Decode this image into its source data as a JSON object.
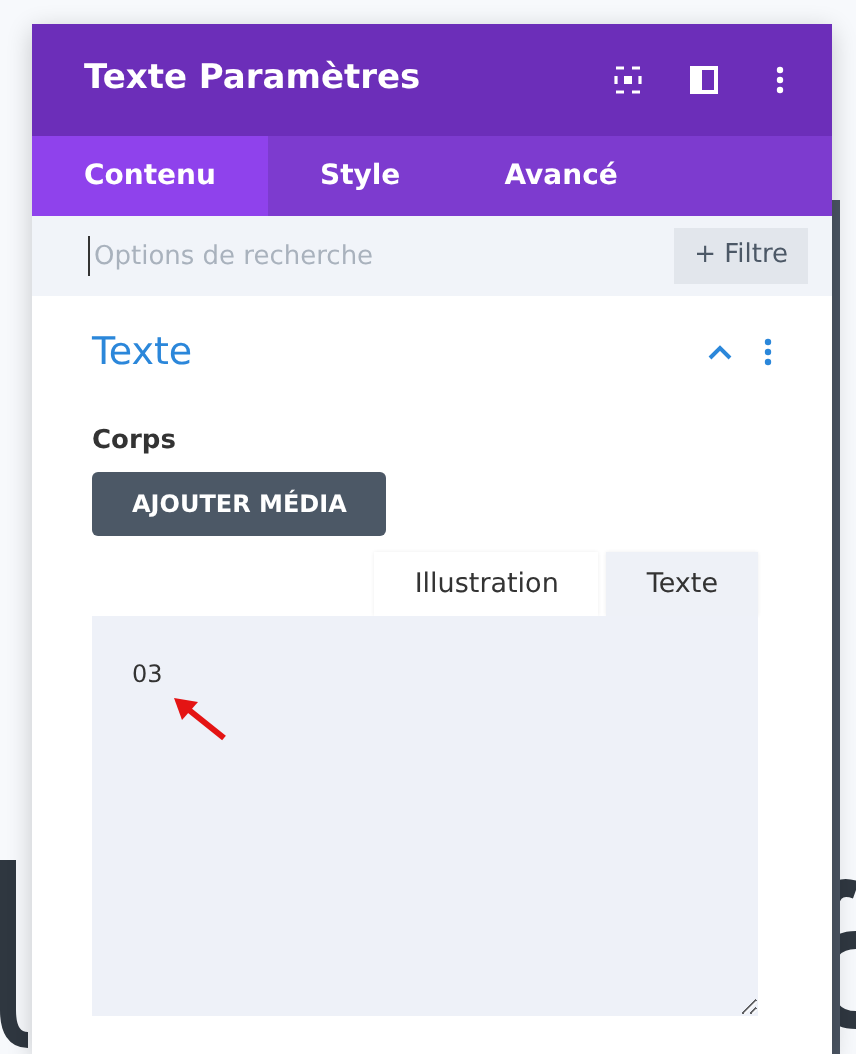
{
  "modal": {
    "title": "Texte Paramètres"
  },
  "tabs": [
    {
      "label": "Contenu",
      "selected": true
    },
    {
      "label": "Style",
      "selected": false
    },
    {
      "label": "Avancé",
      "selected": false
    }
  ],
  "search": {
    "placeholder": "Options de recherche",
    "filter_label": "+ Filtre"
  },
  "section": {
    "title": "Texte",
    "expanded": true,
    "field_label": "Corps",
    "media_button": "AJOUTER MÉDIA",
    "editor_tabs": [
      {
        "label": "Illustration",
        "selected": false
      },
      {
        "label": "Texte",
        "selected": true
      }
    ],
    "editor_value": "03"
  }
}
